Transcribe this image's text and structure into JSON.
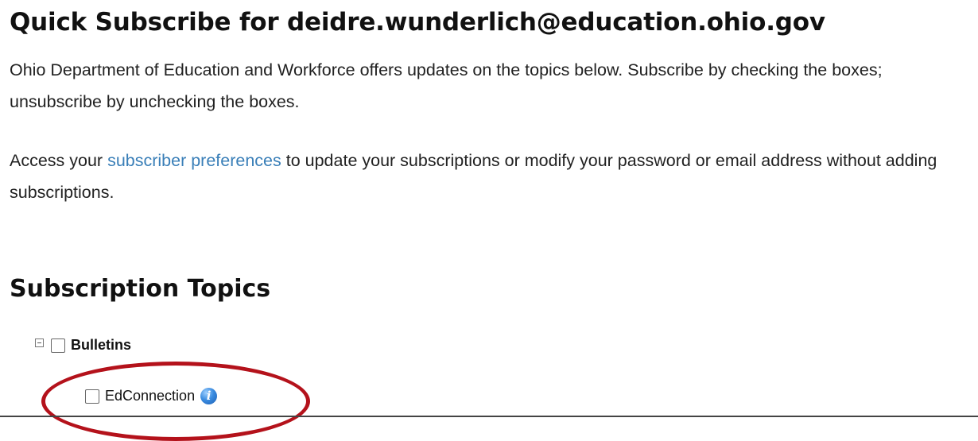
{
  "header": {
    "title": "Quick Subscribe for deidre.wunderlich@education.ohio.gov"
  },
  "intro": {
    "text": "Ohio Department of Education and Workforce offers updates on the topics below. Subscribe by checking the boxes; unsubscribe by unchecking the boxes."
  },
  "access": {
    "prefix": "Access your ",
    "link_label": "subscriber preferences",
    "suffix": " to update your subscriptions or modify your password or email address without adding subscriptions."
  },
  "topics": {
    "heading": "Subscription Topics",
    "items": [
      {
        "label": "Bulletins",
        "expanded": true,
        "checked": false
      },
      {
        "label": "EdConnection",
        "checked": false,
        "info_icon": "info-icon"
      }
    ]
  },
  "colors": {
    "link": "#3a7fb8",
    "highlight": "#b4121b",
    "info_icon": "#3b8ce0"
  }
}
